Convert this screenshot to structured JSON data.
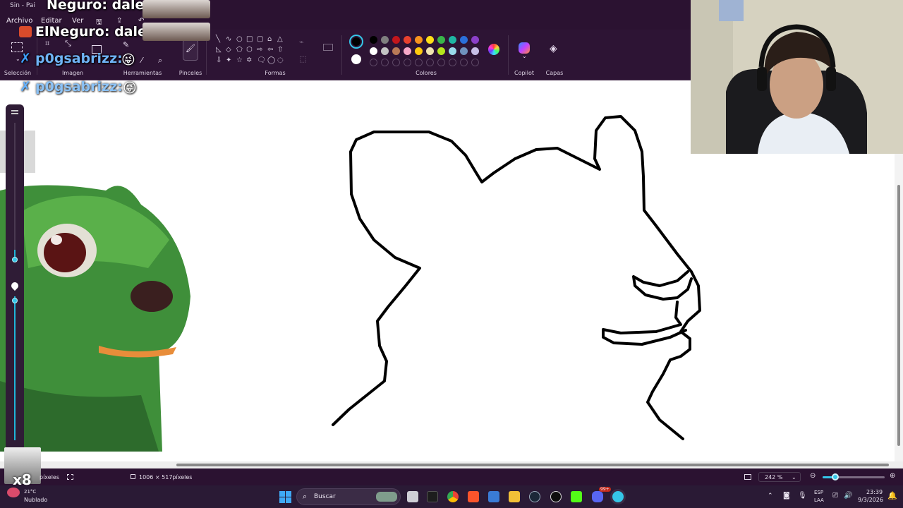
{
  "window": {
    "title_fragment": "Sin",
    "title_suffix": "- Pai"
  },
  "menu": [
    "Archivo",
    "Editar",
    "Ver"
  ],
  "ribbon_groups": {
    "seleccion": "Selección",
    "imagen": "Imagen",
    "herramientas": "Herramientas",
    "pinceles": "Pinceles",
    "formas": "Formas",
    "colores": "Colores",
    "copilot": "Copilot",
    "capas": "Capas"
  },
  "palette": {
    "row1": [
      "#000000",
      "#7f7f7f",
      "#c3161c",
      "#e8412e",
      "#f7931e",
      "#ffde17",
      "#39b54a",
      "#1fb5a3",
      "#2a6fdb",
      "#8b3fc8"
    ],
    "row2": [
      "#ffffff",
      "#c3c3c3",
      "#b97a57",
      "#f7a8c8",
      "#ffc90e",
      "#efe4b0",
      "#b5e61d",
      "#99d9ea",
      "#7092be",
      "#c8bfe7"
    ],
    "primary": "#000000",
    "secondary": "#ffffff",
    "accent": "#35c6e8"
  },
  "chat": [
    {
      "user": "Negur",
      "text": "o: dalee"
    },
    {
      "user": "ElNeguro:",
      "text": "dalee"
    },
    {
      "user": "p0gsabrizz:",
      "text": ""
    },
    {
      "user": "p0gsabrizz:",
      "text": ""
    }
  ],
  "status": {
    "selection_unit": "píxeles",
    "canvas_size": "1006 × 517píxeles",
    "zoom": "242 %",
    "x_badge": "x8",
    "zoom_fraction": 0.2
  },
  "taskbar": {
    "weather_temp": "21°C",
    "weather_desc": "Nublado",
    "search_placeholder": "Buscar",
    "lang_top": "ESP",
    "lang_bottom": "LAA",
    "time": "23:39",
    "date": "9/3/2026",
    "notif_badge": "99+"
  }
}
